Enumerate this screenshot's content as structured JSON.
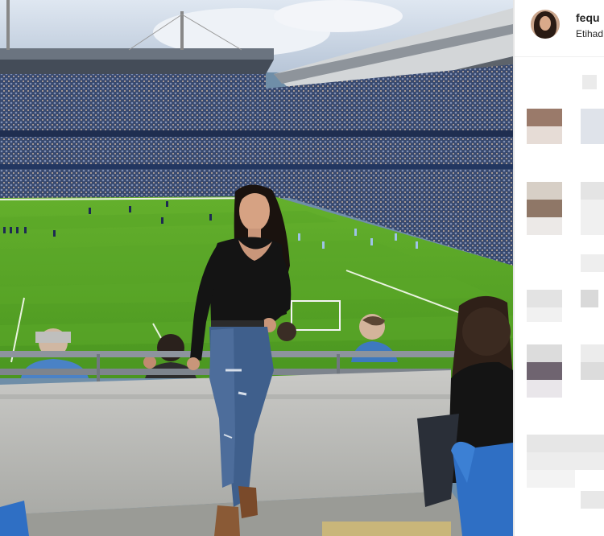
{
  "post": {
    "username": "fequ",
    "location": "Etihad",
    "avatar_icon": "profile-avatar"
  },
  "colors": {
    "pitch": "#4f9a22",
    "sky": "#c9d6e6",
    "seat_blue": "#2f6fc4",
    "outfit_black": "#141414",
    "jeans": "#3f5f8c"
  }
}
